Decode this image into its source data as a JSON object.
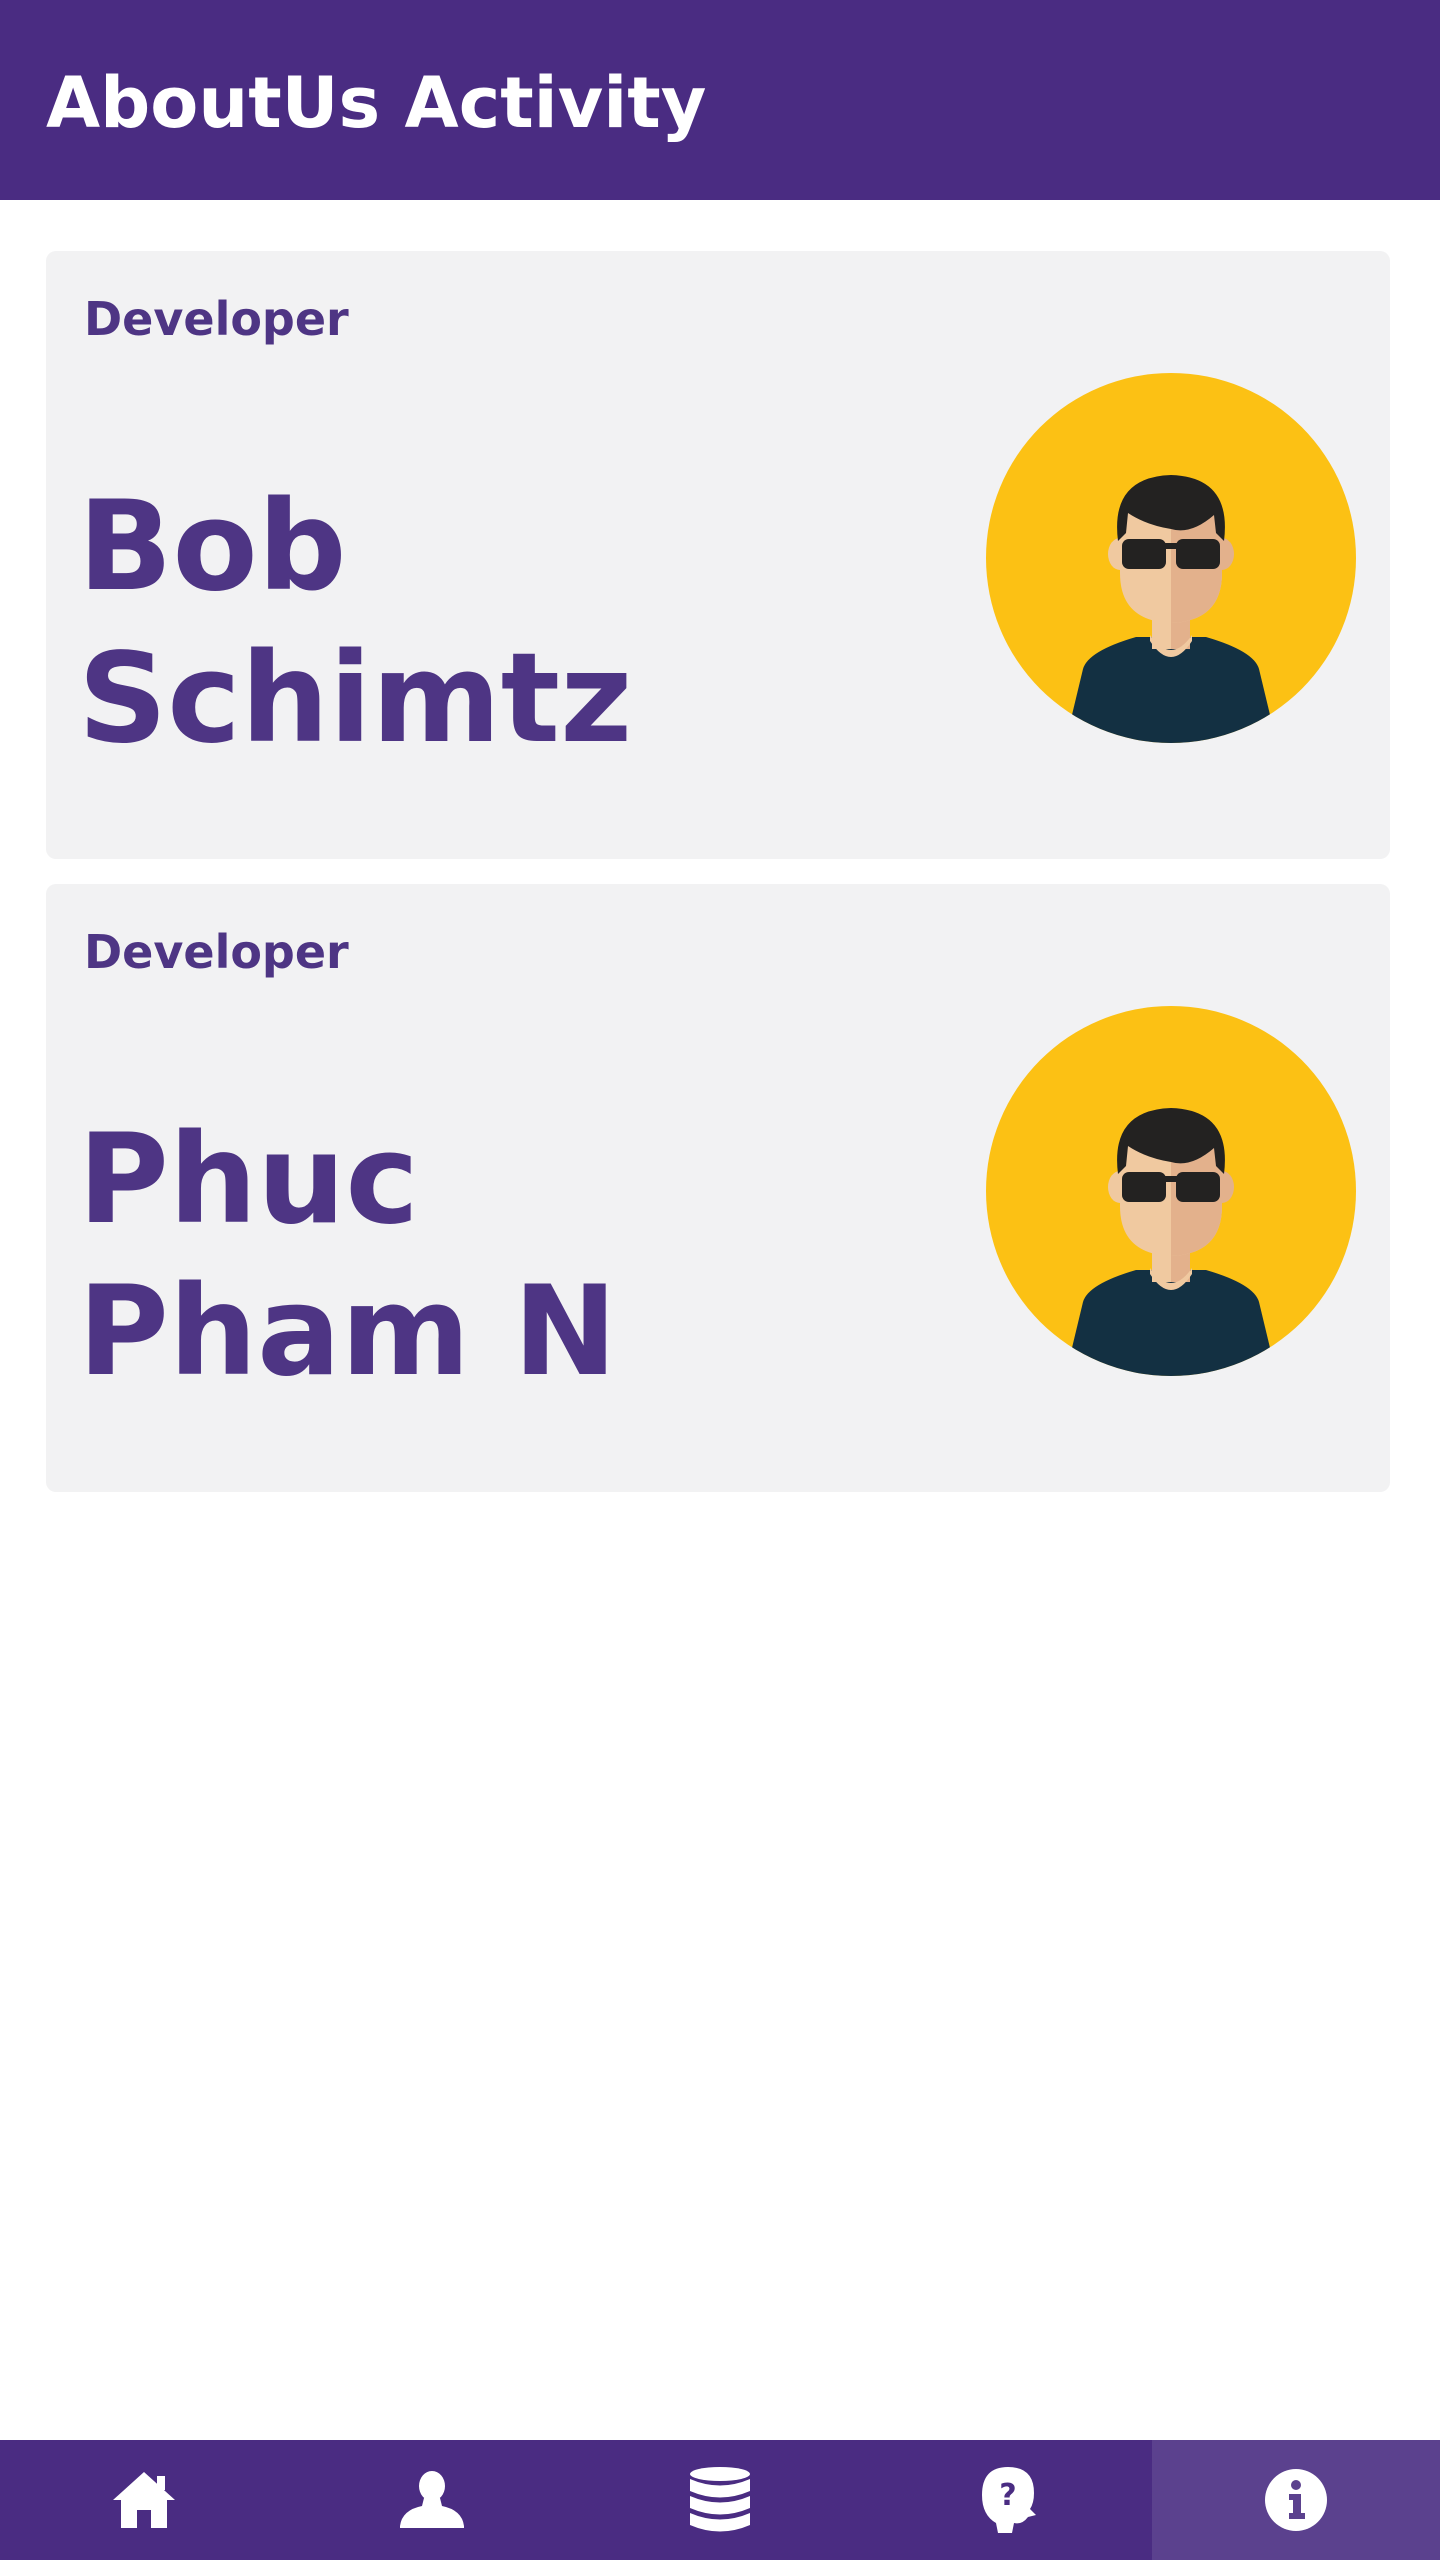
{
  "app_bar": {
    "title": "AboutUs Activity",
    "background": "#4a2c82"
  },
  "cards": [
    {
      "role": "Developer",
      "name_line1": "Bob",
      "name_line2": "Schimtz",
      "avatar_icon": "developer-avatar-sunglasses"
    },
    {
      "role": "Developer",
      "name_line1": "Phuc",
      "name_line2": "Pham N",
      "avatar_icon": "developer-avatar-sunglasses"
    }
  ],
  "bottom_nav": {
    "items": [
      {
        "icon": "home-icon",
        "active": false
      },
      {
        "icon": "person-icon",
        "active": false
      },
      {
        "icon": "database-icon",
        "active": false
      },
      {
        "icon": "help-head-icon",
        "active": false
      },
      {
        "icon": "info-icon",
        "active": true
      }
    ]
  },
  "colors": {
    "primary": "#4a2c82",
    "text_accent": "#4e3584",
    "card_bg": "#f2f2f3",
    "avatar_bg": "#fcc114",
    "nav_active": "#5b418e"
  }
}
